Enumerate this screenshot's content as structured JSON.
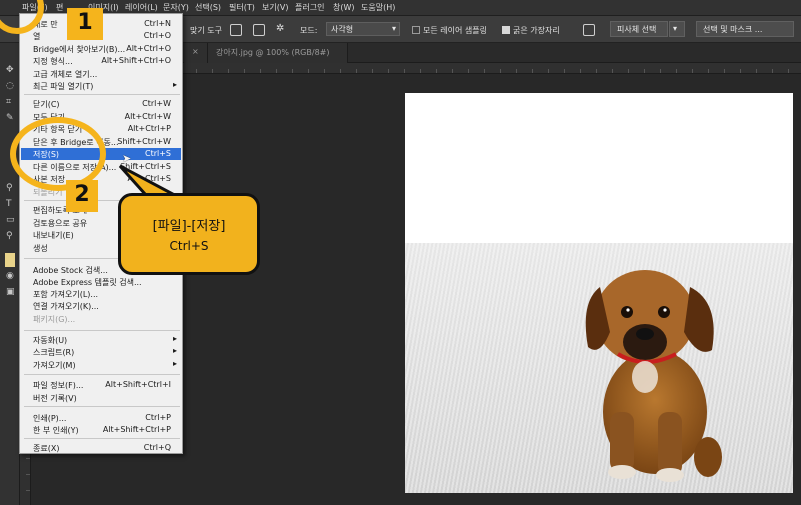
{
  "menubar": {
    "items": [
      "파일(F)",
      "편",
      "이미지(I)",
      "레이어(L)",
      "문자(Y)",
      "선택(S)",
      "필터(T)",
      "보기(V)",
      "플러그인",
      "창(W)",
      "도움말(H)"
    ]
  },
  "options_bar": {
    "tool_label": "맞기 도구",
    "mode_label": "모드:",
    "mode_value": "사각형",
    "sample_all_layers": "모든 레이어 샘플링",
    "hard_edges": "굵은 가장자리",
    "select_subject": "피사체 선택",
    "select_and_mask": "선택 및 마스크 ..."
  },
  "tab_bar": {
    "doc_tab": "강아지.jpg @ 100% (RGB/8#)"
  },
  "file_menu": {
    "items": [
      {
        "label": "새로 만",
        "shortcut": "Ctrl+N"
      },
      {
        "label": "열",
        "shortcut": "Ctrl+O"
      },
      {
        "label": "Bridge에서 찾아보기(B)...",
        "shortcut": "Alt+Ctrl+O"
      },
      {
        "label": "지정 형식...",
        "shortcut": "Alt+Shift+Ctrl+O"
      },
      {
        "label": "고급 개체로 열기...",
        "shortcut": ""
      },
      {
        "label": "최근 파일 열기(T)",
        "shortcut": ""
      },
      {
        "label": "닫기(C)",
        "shortcut": "Ctrl+W"
      },
      {
        "label": "모두 닫기",
        "shortcut": "Alt+Ctrl+W"
      },
      {
        "label": "기타 항목 닫기",
        "shortcut": "Alt+Ctrl+P"
      },
      {
        "label": "닫은 후 Bridge로 이동...",
        "shortcut": "Shift+Ctrl+W"
      },
      {
        "label": "저장(S)",
        "shortcut": "Ctrl+S"
      },
      {
        "label": "다른 이름으로 저장(A)...",
        "shortcut": "Shift+Ctrl+S"
      },
      {
        "label": "사본 저장",
        "shortcut": "Alt+Ctrl+S"
      },
      {
        "label": "되돌리기",
        "shortcut": ""
      },
      {
        "label": "편집하도록 초대",
        "shortcut": ""
      },
      {
        "label": "검토용으로 공유",
        "shortcut": ""
      },
      {
        "label": "내보내기(E)",
        "shortcut": ""
      },
      {
        "label": "생성",
        "shortcut": ""
      },
      {
        "label": "Adobe Stock 검색...",
        "shortcut": ""
      },
      {
        "label": "Adobe Express 템플릿 검색...",
        "shortcut": ""
      },
      {
        "label": "포함 가져오기(L)...",
        "shortcut": ""
      },
      {
        "label": "연결 가져오기(K)...",
        "shortcut": ""
      },
      {
        "label": "패키지(G)...",
        "shortcut": ""
      },
      {
        "label": "자동화(U)",
        "shortcut": ""
      },
      {
        "label": "스크립트(R)",
        "shortcut": ""
      },
      {
        "label": "가져오기(M)",
        "shortcut": ""
      },
      {
        "label": "파일 정보(F)...",
        "shortcut": "Alt+Shift+Ctrl+I"
      },
      {
        "label": "버전 기록(V)",
        "shortcut": ""
      },
      {
        "label": "인쇄(P)...",
        "shortcut": "Ctrl+P"
      },
      {
        "label": "한 부 인쇄(Y)",
        "shortcut": "Alt+Shift+Ctrl+P"
      },
      {
        "label": "종료(X)",
        "shortcut": "Ctrl+Q"
      }
    ]
  },
  "callouts": {
    "step1": "1",
    "step2": "2",
    "bubble_title": "[파일]-[저장]",
    "bubble_shortcut": "Ctrl+S"
  },
  "colors": {
    "accent": "#f5b41c",
    "selection": "#2f6fd6"
  }
}
